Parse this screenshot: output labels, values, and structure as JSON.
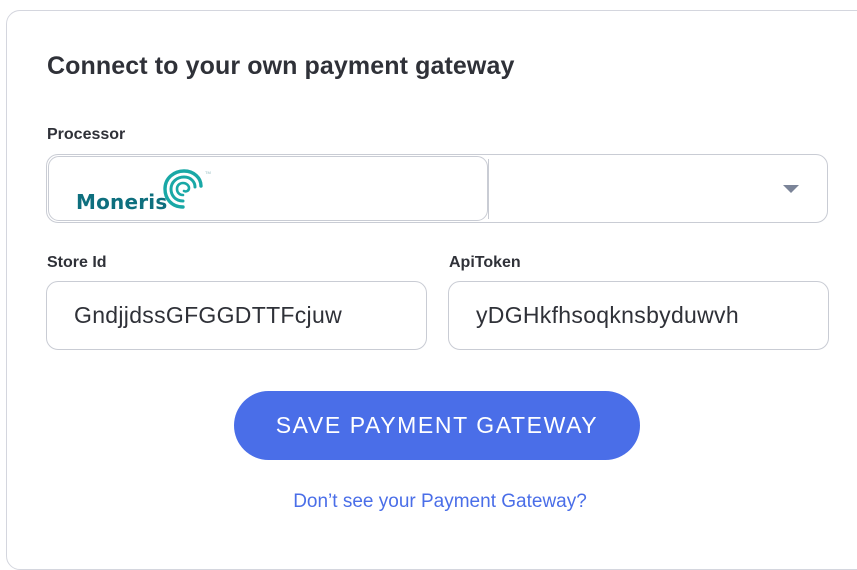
{
  "form": {
    "title": "Connect to your own payment gateway",
    "processor_label": "Processor",
    "processor_selected": "Moneris",
    "store_id_label": "Store Id",
    "store_id_value": "GndjjdssGFGGDTTFcjuw",
    "api_token_label": "ApiToken",
    "api_token_value": "yDGHkfhsoqknsbyduwvh",
    "save_button_label": "SAVE PAYMENT GATEWAY",
    "help_link_text": "Don’t see your Payment Gateway?"
  },
  "colors": {
    "accent": "#4a6ee8",
    "moneris_brand": "#0e6f7e",
    "text": "#2f3138",
    "border": "#c9ccd4"
  },
  "icons": {
    "dropdown": "chevron-down-icon",
    "logo": "moneris-logo"
  }
}
